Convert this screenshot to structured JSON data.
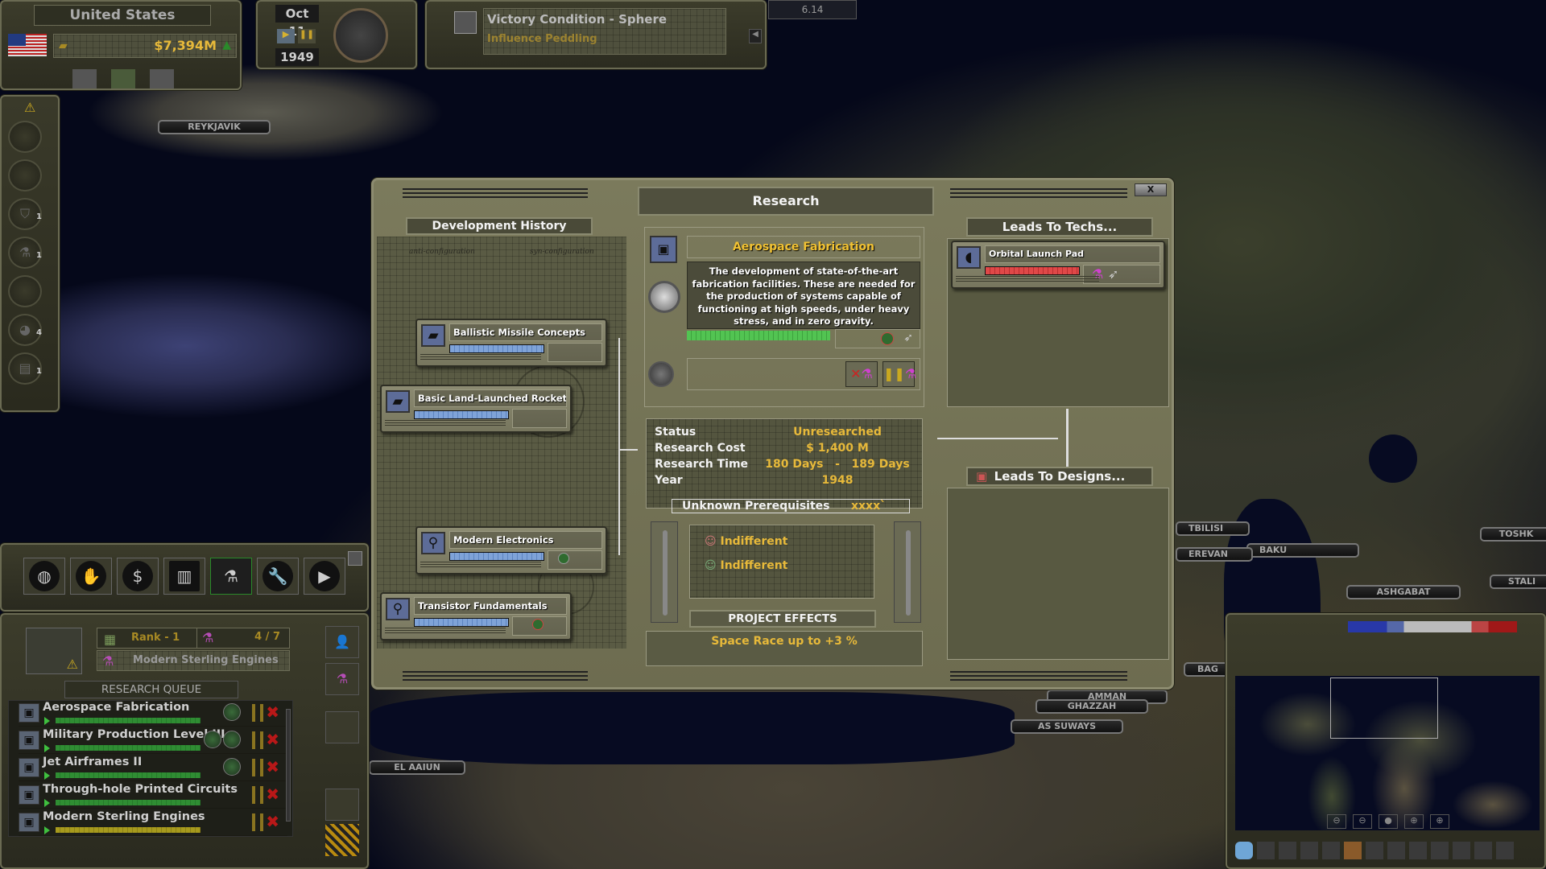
{
  "top_bar": {
    "country": "United States",
    "treasury": "$7,394M",
    "date": "Oct 11",
    "year": "1949",
    "victory_title": "Victory Condition - Sphere",
    "victory_sub": "Influence Peddling",
    "version": "6.14"
  },
  "alerts_sidebar": {
    "buttons": [
      {
        "icon": "radar-icon",
        "count": ""
      },
      {
        "icon": "fist-icon",
        "count": ""
      },
      {
        "icon": "shield-icon",
        "count": "1"
      },
      {
        "icon": "flask-icon",
        "count": "1"
      },
      {
        "icon": "money-icon",
        "count": ""
      },
      {
        "icon": "globe-icon",
        "count": "4"
      },
      {
        "icon": "document-icon",
        "count": "1"
      }
    ]
  },
  "map_labels": [
    "REYKJAVIK",
    "TBILISI",
    "BAKU",
    "EREVAN",
    "ASHGABAT",
    "TOSHK",
    "STALI",
    "BAG",
    "AMMAN",
    "GHAZZAH",
    "AS SUWAYS",
    "EL AAIUN"
  ],
  "research_dialog": {
    "title": "Research",
    "close_label": "X",
    "history": {
      "title": "Development History",
      "techs": [
        {
          "name": "Ballistic Missile Concepts",
          "progress": 1.0,
          "icon": "missile-launcher-icon"
        },
        {
          "name": "Basic Land-Launched Rockets",
          "progress": 1.0,
          "icon": "missile-launcher-icon"
        },
        {
          "name": "Modern Electronics",
          "progress": 1.0,
          "icon": "microscope-icon"
        },
        {
          "name": "Transistor Fundamentals",
          "progress": 1.0,
          "icon": "microscope-icon"
        }
      ]
    },
    "current": {
      "name": "Aerospace Fabrication",
      "description": "The development of state-of-the-art fabrication facilities.  These are needed for the production of systems capable of functioning at high speeds, under heavy stress, and in zero gravity.",
      "progress": 1.0,
      "stats": [
        {
          "label": "Status",
          "value": "Unresearched"
        },
        {
          "label": "Research Cost",
          "value": "$ 1,400 M"
        },
        {
          "label": "Research Time",
          "value": "180 Days   -   189 Days"
        },
        {
          "label": "Year",
          "value": "1948"
        }
      ],
      "prereq_label": "Unknown Prerequisites",
      "prereq_value": "xxxx`",
      "opinions": [
        "Indifferent",
        "Indifferent"
      ],
      "effects_title": "PROJECT EFFECTS",
      "effects": "Space Race up to +3 %"
    },
    "leads_to_techs": {
      "title": "Leads To Techs...",
      "techs": [
        {
          "name": "Orbital Launch Pad",
          "progress": 1.0
        }
      ]
    },
    "leads_to_designs": {
      "title": "Leads To Designs..."
    }
  },
  "research_panel": {
    "tabs": [
      "globe",
      "diplomacy",
      "finance",
      "supply",
      "research",
      "military-build",
      "military-ops"
    ],
    "rank": "Rank - 1",
    "slots": "4 / 7",
    "current_project": "Modern Sterling Engines",
    "queue_title": "RESEARCH QUEUE",
    "queue": [
      {
        "name": "Aerospace Fabrication",
        "bar": "green"
      },
      {
        "name": "Military Production Level III",
        "bar": "green"
      },
      {
        "name": "Jet Airframes II",
        "bar": "green"
      },
      {
        "name": "Through-hole Printed Circuits",
        "bar": "green"
      },
      {
        "name": "Modern Sterling Engines",
        "bar": "yellow"
      }
    ]
  },
  "minimap": {
    "zoom_buttons": [
      "zoom-out-max",
      "zoom-out",
      "zoom-reset",
      "zoom-in",
      "zoom-in-max"
    ]
  }
}
